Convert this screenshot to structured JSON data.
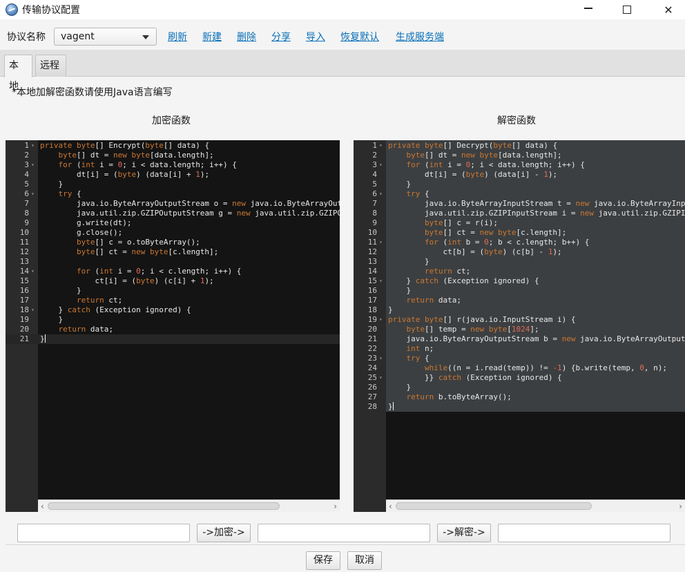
{
  "window": {
    "title": "传输协议配置",
    "minimize_glyph": "—",
    "close_glyph": "✕"
  },
  "toolbar": {
    "protocol_label": "协议名称",
    "protocol_selected": "vagent",
    "links": {
      "refresh": "刷新",
      "new": "新建",
      "delete": "删除",
      "share": "分享",
      "import": "导入",
      "restore_default": "恢复默认",
      "generate_server": "生成服务端"
    }
  },
  "tabs": {
    "local": "本地",
    "remote": "远程"
  },
  "hint": "*本地加解密函数请使用Java语言编写",
  "encrypt_pane": {
    "title": "加密函数",
    "lines": [
      [
        {
          "t": "private byte",
          "c": "kw"
        },
        {
          "t": "[] Encrypt("
        },
        {
          "t": "byte",
          "c": "kw"
        },
        {
          "t": "[] data) {"
        }
      ],
      [
        {
          "t": "    "
        },
        {
          "t": "byte",
          "c": "kw"
        },
        {
          "t": "[] dt = "
        },
        {
          "t": "new byte",
          "c": "kw"
        },
        {
          "t": "[data.length];"
        }
      ],
      [
        {
          "t": "    "
        },
        {
          "t": "for",
          "c": "kw"
        },
        {
          "t": " ("
        },
        {
          "t": "int",
          "c": "kw"
        },
        {
          "t": " i = "
        },
        {
          "t": "0",
          "c": "num"
        },
        {
          "t": "; i < data.length; i++) {"
        }
      ],
      [
        {
          "t": "        dt[i] = ("
        },
        {
          "t": "byte",
          "c": "kw"
        },
        {
          "t": ") (data[i] + "
        },
        {
          "t": "1",
          "c": "num"
        },
        {
          "t": ");"
        }
      ],
      [
        {
          "t": "    }"
        }
      ],
      [
        {
          "t": "    "
        },
        {
          "t": "try",
          "c": "kw"
        },
        {
          "t": " {"
        }
      ],
      [
        {
          "t": "        java.io.ByteArrayOutputStream o = "
        },
        {
          "t": "new",
          "c": "kw"
        },
        {
          "t": " java.io.ByteArrayOutputStream();"
        }
      ],
      [
        {
          "t": "        java.util.zip.GZIPOutputStream g = "
        },
        {
          "t": "new",
          "c": "kw"
        },
        {
          "t": " java.util.zip.GZIPOutputStream(o);"
        }
      ],
      [
        {
          "t": "        g.write(dt);"
        }
      ],
      [
        {
          "t": "        g.close();"
        }
      ],
      [
        {
          "t": "        "
        },
        {
          "t": "byte",
          "c": "kw"
        },
        {
          "t": "[] c = o.toByteArray();"
        }
      ],
      [
        {
          "t": "        "
        },
        {
          "t": "byte",
          "c": "kw"
        },
        {
          "t": "[] ct = "
        },
        {
          "t": "new byte",
          "c": "kw"
        },
        {
          "t": "[c.length];"
        }
      ],
      [
        {
          "t": ""
        }
      ],
      [
        {
          "t": "        "
        },
        {
          "t": "for",
          "c": "kw"
        },
        {
          "t": " ("
        },
        {
          "t": "int",
          "c": "kw"
        },
        {
          "t": " i = "
        },
        {
          "t": "0",
          "c": "num"
        },
        {
          "t": "; i < c.length; i++) {"
        }
      ],
      [
        {
          "t": "            ct[i] = ("
        },
        {
          "t": "byte",
          "c": "kw"
        },
        {
          "t": ") (c[i] + "
        },
        {
          "t": "1",
          "c": "num"
        },
        {
          "t": ");"
        }
      ],
      [
        {
          "t": "        }"
        }
      ],
      [
        {
          "t": "        "
        },
        {
          "t": "return",
          "c": "kw"
        },
        {
          "t": " ct;"
        }
      ],
      [
        {
          "t": "    } "
        },
        {
          "t": "catch",
          "c": "kw"
        },
        {
          "t": " (Exception ignored) {"
        }
      ],
      [
        {
          "t": "    }"
        }
      ],
      [
        {
          "t": "    "
        },
        {
          "t": "return",
          "c": "kw"
        },
        {
          "t": " data;"
        }
      ],
      [
        {
          "t": "}"
        }
      ]
    ],
    "fold_lines": [
      1,
      3,
      6,
      14,
      18
    ]
  },
  "decrypt_pane": {
    "title": "解密函数",
    "lines": [
      [
        {
          "t": "private byte",
          "c": "kw"
        },
        {
          "t": "[] Decrypt("
        },
        {
          "t": "byte",
          "c": "kw"
        },
        {
          "t": "[] data) {"
        }
      ],
      [
        {
          "t": "    "
        },
        {
          "t": "byte",
          "c": "kw"
        },
        {
          "t": "[] dt = "
        },
        {
          "t": "new byte",
          "c": "kw"
        },
        {
          "t": "[data.length];"
        }
      ],
      [
        {
          "t": "    "
        },
        {
          "t": "for",
          "c": "kw"
        },
        {
          "t": " ("
        },
        {
          "t": "int",
          "c": "kw"
        },
        {
          "t": " i = "
        },
        {
          "t": "0",
          "c": "num"
        },
        {
          "t": "; i < data.length; i++) {"
        }
      ],
      [
        {
          "t": "        dt[i] = ("
        },
        {
          "t": "byte",
          "c": "kw"
        },
        {
          "t": ") (data[i] - "
        },
        {
          "t": "1",
          "c": "num"
        },
        {
          "t": ");"
        }
      ],
      [
        {
          "t": "    }"
        }
      ],
      [
        {
          "t": "    "
        },
        {
          "t": "try",
          "c": "kw"
        },
        {
          "t": " {"
        }
      ],
      [
        {
          "t": "        java.io.ByteArrayInputStream t = "
        },
        {
          "t": "new",
          "c": "kw"
        },
        {
          "t": " java.io.ByteArrayInputStream(dt);"
        }
      ],
      [
        {
          "t": "        java.util.zip.GZIPInputStream i = "
        },
        {
          "t": "new",
          "c": "kw"
        },
        {
          "t": " java.util.zip.GZIPInputStream(t);"
        }
      ],
      [
        {
          "t": "        "
        },
        {
          "t": "byte",
          "c": "kw"
        },
        {
          "t": "[] c = r(i);"
        }
      ],
      [
        {
          "t": "        "
        },
        {
          "t": "byte",
          "c": "kw"
        },
        {
          "t": "[] ct = "
        },
        {
          "t": "new byte",
          "c": "kw"
        },
        {
          "t": "[c.length];"
        }
      ],
      [
        {
          "t": "        "
        },
        {
          "t": "for",
          "c": "kw"
        },
        {
          "t": " ("
        },
        {
          "t": "int",
          "c": "kw"
        },
        {
          "t": " b = "
        },
        {
          "t": "0",
          "c": "num"
        },
        {
          "t": "; b < c.length; b++) {"
        }
      ],
      [
        {
          "t": "            ct[b] = ("
        },
        {
          "t": "byte",
          "c": "kw"
        },
        {
          "t": ") (c[b] - "
        },
        {
          "t": "1",
          "c": "num"
        },
        {
          "t": ");"
        }
      ],
      [
        {
          "t": "        }"
        }
      ],
      [
        {
          "t": "        "
        },
        {
          "t": "return",
          "c": "kw"
        },
        {
          "t": " ct;"
        }
      ],
      [
        {
          "t": "    } "
        },
        {
          "t": "catch",
          "c": "kw"
        },
        {
          "t": " (Exception ignored) {"
        }
      ],
      [
        {
          "t": "    }"
        }
      ],
      [
        {
          "t": "    "
        },
        {
          "t": "return",
          "c": "kw"
        },
        {
          "t": " data;"
        }
      ],
      [
        {
          "t": "}"
        }
      ],
      [
        {
          "t": "private byte",
          "c": "kw"
        },
        {
          "t": "[] r(java.io.InputStream i) {"
        }
      ],
      [
        {
          "t": "    "
        },
        {
          "t": "byte",
          "c": "kw"
        },
        {
          "t": "[] temp = "
        },
        {
          "t": "new byte",
          "c": "kw"
        },
        {
          "t": "["
        },
        {
          "t": "1024",
          "c": "num"
        },
        {
          "t": "];"
        }
      ],
      [
        {
          "t": "    java.io.ByteArrayOutputStream b = "
        },
        {
          "t": "new",
          "c": "kw"
        },
        {
          "t": " java.io.ByteArrayOutputStream();"
        }
      ],
      [
        {
          "t": "    "
        },
        {
          "t": "int",
          "c": "kw"
        },
        {
          "t": " n;"
        }
      ],
      [
        {
          "t": "    "
        },
        {
          "t": "try",
          "c": "kw"
        },
        {
          "t": " {"
        }
      ],
      [
        {
          "t": "        "
        },
        {
          "t": "while",
          "c": "kw"
        },
        {
          "t": "((n = i.read(temp)) != "
        },
        {
          "t": "-1",
          "c": "num"
        },
        {
          "t": ") {b.write(temp, "
        },
        {
          "t": "0",
          "c": "num"
        },
        {
          "t": ", n);"
        }
      ],
      [
        {
          "t": "        }} "
        },
        {
          "t": "catch",
          "c": "kw"
        },
        {
          "t": " (Exception ignored) {"
        }
      ],
      [
        {
          "t": "    }"
        }
      ],
      [
        {
          "t": "    "
        },
        {
          "t": "return",
          "c": "kw"
        },
        {
          "t": " b.toByteArray();"
        }
      ],
      [
        {
          "t": "}"
        }
      ]
    ],
    "fold_lines": [
      1,
      3,
      6,
      11,
      15,
      19,
      23,
      25
    ]
  },
  "bottom": {
    "encrypt_input_value": "",
    "encrypt_button": "->加密->",
    "encrypted_output_value": "",
    "decrypt_button": "->解密->",
    "decrypted_output_value": "",
    "save_button": "保存",
    "cancel_button": "取消"
  }
}
